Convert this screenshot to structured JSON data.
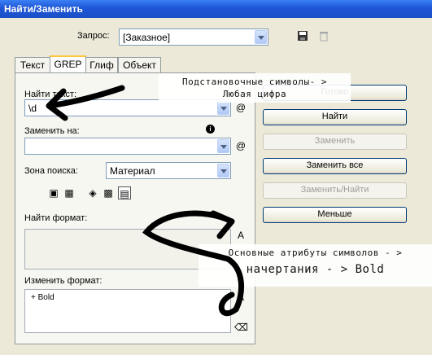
{
  "window": {
    "title": "Найти/Заменить"
  },
  "query": {
    "label": "Запрос:",
    "value": "[Заказное]"
  },
  "tabs": [
    "Текст",
    "GREP",
    "Глиф",
    "Объект"
  ],
  "find_text": {
    "label": "Найти текст:",
    "value": "\\d"
  },
  "replace_with": {
    "label": "Заменить на:",
    "value": ""
  },
  "search_zone": {
    "label": "Зона поиска:",
    "value": "Материал"
  },
  "find_format": {
    "label": "Найти формат:",
    "value": ""
  },
  "change_format": {
    "label": "Изменить формат:",
    "value": "+ Bold"
  },
  "buttons": {
    "done": "Готово",
    "find": "Найти",
    "replace": "Заменить",
    "replace_all": "Заменить все",
    "replace_find": "Заменить/Найти",
    "fewer": "Меньше"
  },
  "annotations": {
    "tip1_line1": "Подстановочные символы- >",
    "tip1_line2": "Любая цифра",
    "tip2_line1": "Основные атрибуты символов - >",
    "tip2_line2": "начертания - > Bold"
  },
  "icons": [
    "save-icon",
    "delete-icon",
    "special-characters-icon",
    "info-icon",
    "include-locked-layers-icon",
    "include-locked-stories-icon",
    "include-hidden-layers-icon",
    "include-master-pages-icon",
    "include-footnotes-icon",
    "format-settings-icon",
    "trash-icon"
  ]
}
